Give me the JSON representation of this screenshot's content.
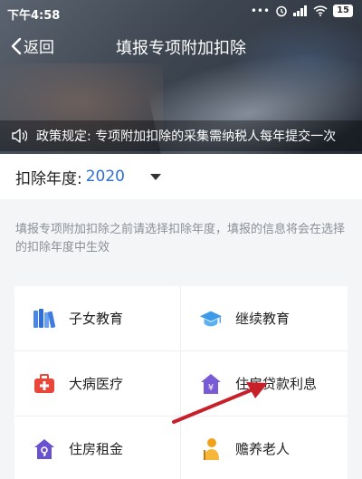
{
  "status_bar": {
    "time": "下午4:58",
    "battery": "15"
  },
  "nav": {
    "back_label": "返回",
    "title": "填报专项附加扣除"
  },
  "policy": {
    "text": "政策规定: 专项附加扣除的采集需纳税人每年提交一次"
  },
  "year_selector": {
    "label": "扣除年度:",
    "value": "2020"
  },
  "notice": {
    "text": "填报专项附加扣除之前请选择扣除年度，填报的信息将会在选择的扣除年度中生效"
  },
  "deductions": [
    {
      "label": "子女教育",
      "icon": "books-icon",
      "color": "#3d7be0"
    },
    {
      "label": "继续教育",
      "icon": "graduation-cap-icon",
      "color": "#3d9ae8"
    },
    {
      "label": "大病医疗",
      "icon": "medical-kit-icon",
      "color": "#e8463a"
    },
    {
      "label": "住房贷款利息",
      "icon": "house-loan-icon",
      "color": "#7a5bd6"
    },
    {
      "label": "住房租金",
      "icon": "house-key-icon",
      "color": "#6a52cf"
    },
    {
      "label": "赡养老人",
      "icon": "elderly-person-icon",
      "color": "#f0a21a"
    }
  ],
  "colors": {
    "accent": "#2f6fd6",
    "arrow": "#c8202a"
  }
}
